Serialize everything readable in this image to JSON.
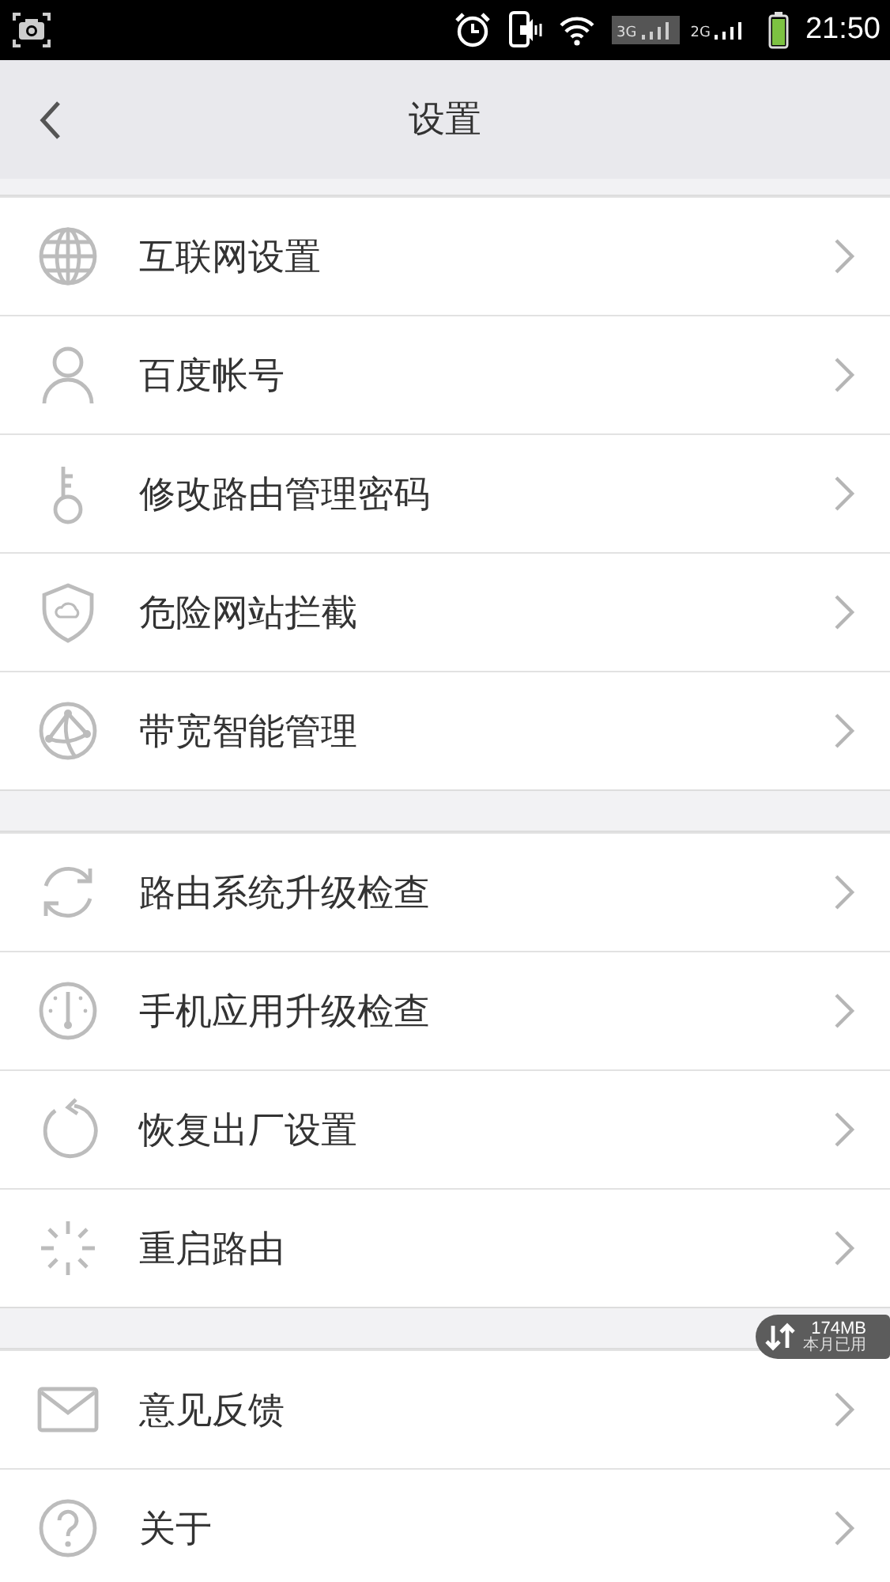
{
  "status_bar": {
    "network_3g": "3G",
    "network_2g": "2G",
    "time": "21:50"
  },
  "header": {
    "title": "设置"
  },
  "groups": [
    {
      "items": [
        {
          "label": "互联网设置"
        },
        {
          "label": "百度帐号"
        },
        {
          "label": "修改路由管理密码"
        },
        {
          "label": "危险网站拦截"
        },
        {
          "label": "带宽智能管理"
        }
      ]
    },
    {
      "items": [
        {
          "label": "路由系统升级检查"
        },
        {
          "label": "手机应用升级检查"
        },
        {
          "label": "恢复出厂设置"
        },
        {
          "label": "重启路由"
        }
      ]
    },
    {
      "items": [
        {
          "label": "意见反馈"
        },
        {
          "label": "关于"
        }
      ]
    }
  ],
  "usage_badge": {
    "amount": "174MB",
    "caption": "本月已用"
  }
}
